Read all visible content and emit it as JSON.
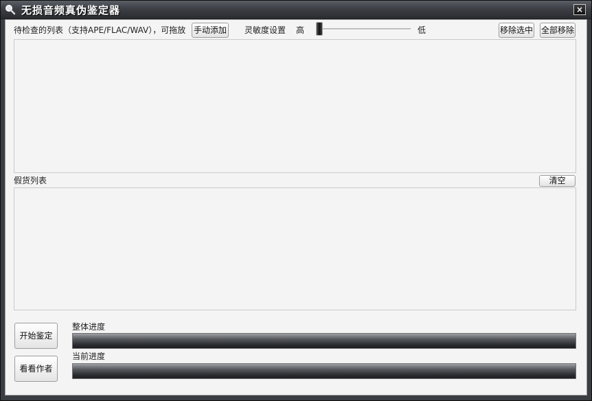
{
  "window": {
    "title": "无损音频真伪鉴定器",
    "close_label": "×"
  },
  "toolbar": {
    "list_label": "待检查的列表（支持APE/FLAC/WAV），可拖放",
    "add_button": "手动添加",
    "sensitivity_label": "灵敏度设置",
    "high_label": "高",
    "low_label": "低",
    "sensitivity_value": 0,
    "remove_selected_button": "移除选中",
    "remove_all_button": "全部移除"
  },
  "fake_list": {
    "label": "假货列表",
    "clear_button": "清空"
  },
  "actions": {
    "start_button": "开始鉴定",
    "author_button": "看看作者"
  },
  "progress": {
    "overall_label": "整体进度",
    "overall_value": 0,
    "current_label": "当前进度",
    "current_value": 0
  },
  "colors": {
    "titlebar": "#3c3f45",
    "client": "#f4f4f4",
    "progress": "#2c2e32"
  },
  "icons": {
    "app": "magnifier-icon",
    "close": "close-icon"
  }
}
